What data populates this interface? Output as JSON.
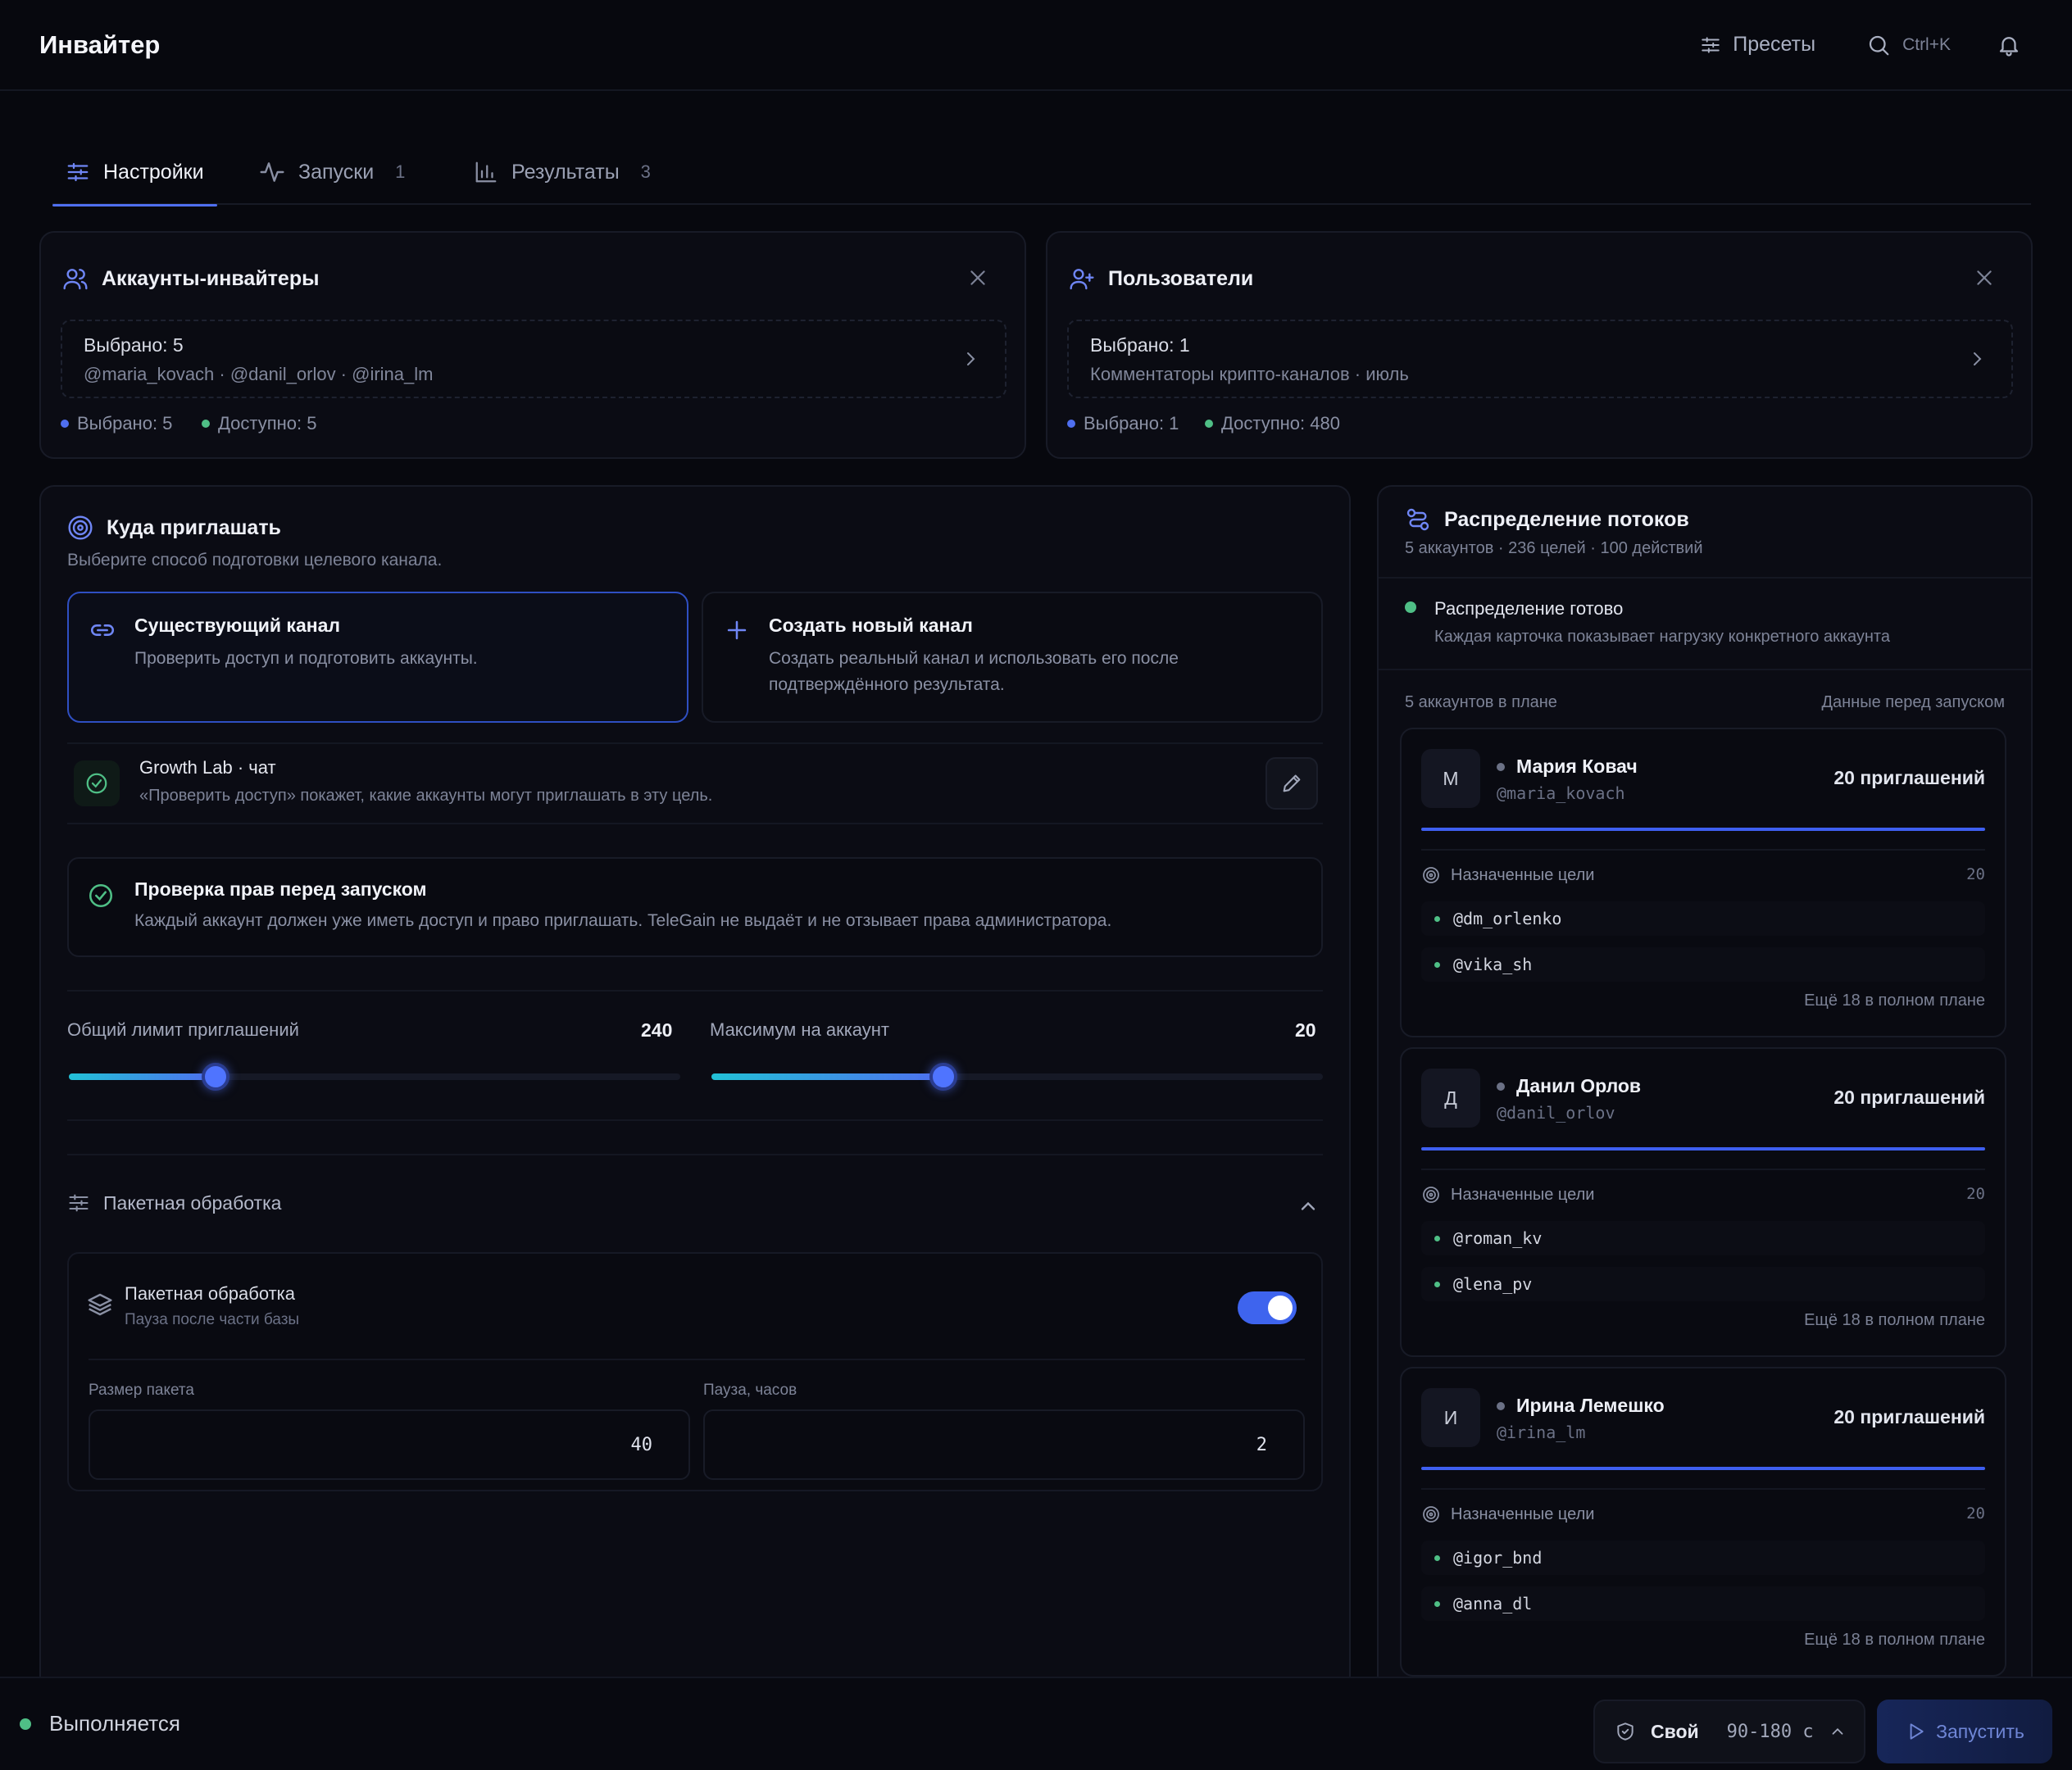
{
  "header": {
    "title": "Инвайтер",
    "presets_label": "Пресеты",
    "search_shortcut": "Ctrl+K"
  },
  "tabs": [
    {
      "label": "Настройки",
      "count": ""
    },
    {
      "label": "Запуски",
      "count": "1"
    },
    {
      "label": "Результаты",
      "count": "3"
    }
  ],
  "inviters": {
    "title": "Аккаунты-инвайтеры",
    "selected_text": "Выбрано: 5",
    "handles": "@maria_kovach · @danil_orlov · @irina_lm",
    "stat_selected": "Выбрано: 5",
    "stat_available": "Доступно: 5"
  },
  "users": {
    "title": "Пользователи",
    "selected_text": "Выбрано: 1",
    "description": "Комментаторы крипто-каналов · июль",
    "stat_selected": "Выбрано: 1",
    "stat_available": "Доступно: 480"
  },
  "target": {
    "title": "Куда приглашать",
    "subtitle": "Выберите способ подготовки целевого канала.",
    "option_existing": {
      "title": "Существующий канал",
      "desc": "Проверить доступ и подготовить аккаунты."
    },
    "option_new": {
      "title": "Создать новый канал",
      "desc": "Создать реальный канал и использовать его после подтверждённого результата."
    },
    "channel_name": "Growth Lab · чат",
    "channel_hint": "«Проверить доступ» покажет, какие аккаунты могут приглашать в эту цель.",
    "check_title": "Проверка прав перед запуском",
    "check_desc": "Каждый аккаунт должен уже иметь доступ и право приглашать. TeleGain не выдаёт и не отзывает права администратора."
  },
  "limits": {
    "total_label": "Общий лимит приглашений",
    "total_value": "240",
    "total_fraction": 0.24,
    "per_account_label": "Максимум на аккаунт",
    "per_account_value": "20",
    "per_account_fraction": 0.38
  },
  "batch": {
    "section_label": "Пакетная обработка",
    "toggle_title": "Пакетная обработка",
    "toggle_desc": "Пауза после части базы",
    "toggle_on": true,
    "size_label": "Размер пакета",
    "size_value": "40",
    "pause_label": "Пауза, часов",
    "pause_value": "2"
  },
  "distribution": {
    "title": "Распределение потоков",
    "subtitle": "5 аккаунтов · 236 целей · 100 действий",
    "ready_title": "Распределение готово",
    "ready_desc": "Каждая карточка показывает нагрузку конкретного аккаунта",
    "plan_left": "5 аккаунтов в плане",
    "plan_right": "Данные перед запуском",
    "targets_label": "Назначенные цели",
    "accounts": [
      {
        "initial": "М",
        "name": "Мария Ковач",
        "handle": "@maria_kovach",
        "invites": "20 приглашений",
        "targets_count": "20",
        "targets": [
          "@dm_orlenko",
          "@vika_sh"
        ],
        "more": "Ещё 18 в полном плане"
      },
      {
        "initial": "Д",
        "name": "Данил Орлов",
        "handle": "@danil_orlov",
        "invites": "20 приглашений",
        "targets_count": "20",
        "targets": [
          "@roman_kv",
          "@lena_pv"
        ],
        "more": "Ещё 18 в полном плане"
      },
      {
        "initial": "И",
        "name": "Ирина Лемешко",
        "handle": "@irina_lm",
        "invites": "20 приглашений",
        "targets_count": "20",
        "targets": [
          "@igor_bnd",
          "@anna_dl"
        ],
        "more": "Ещё 18 в полном плане"
      }
    ]
  },
  "bottom": {
    "status": "Выполняется",
    "mode": "Свой",
    "interval": "90-180 с",
    "run_label": "Запустить"
  },
  "colors": {
    "accent": "#4f6ff0",
    "success": "#4fbf86",
    "background": "#07080e"
  }
}
